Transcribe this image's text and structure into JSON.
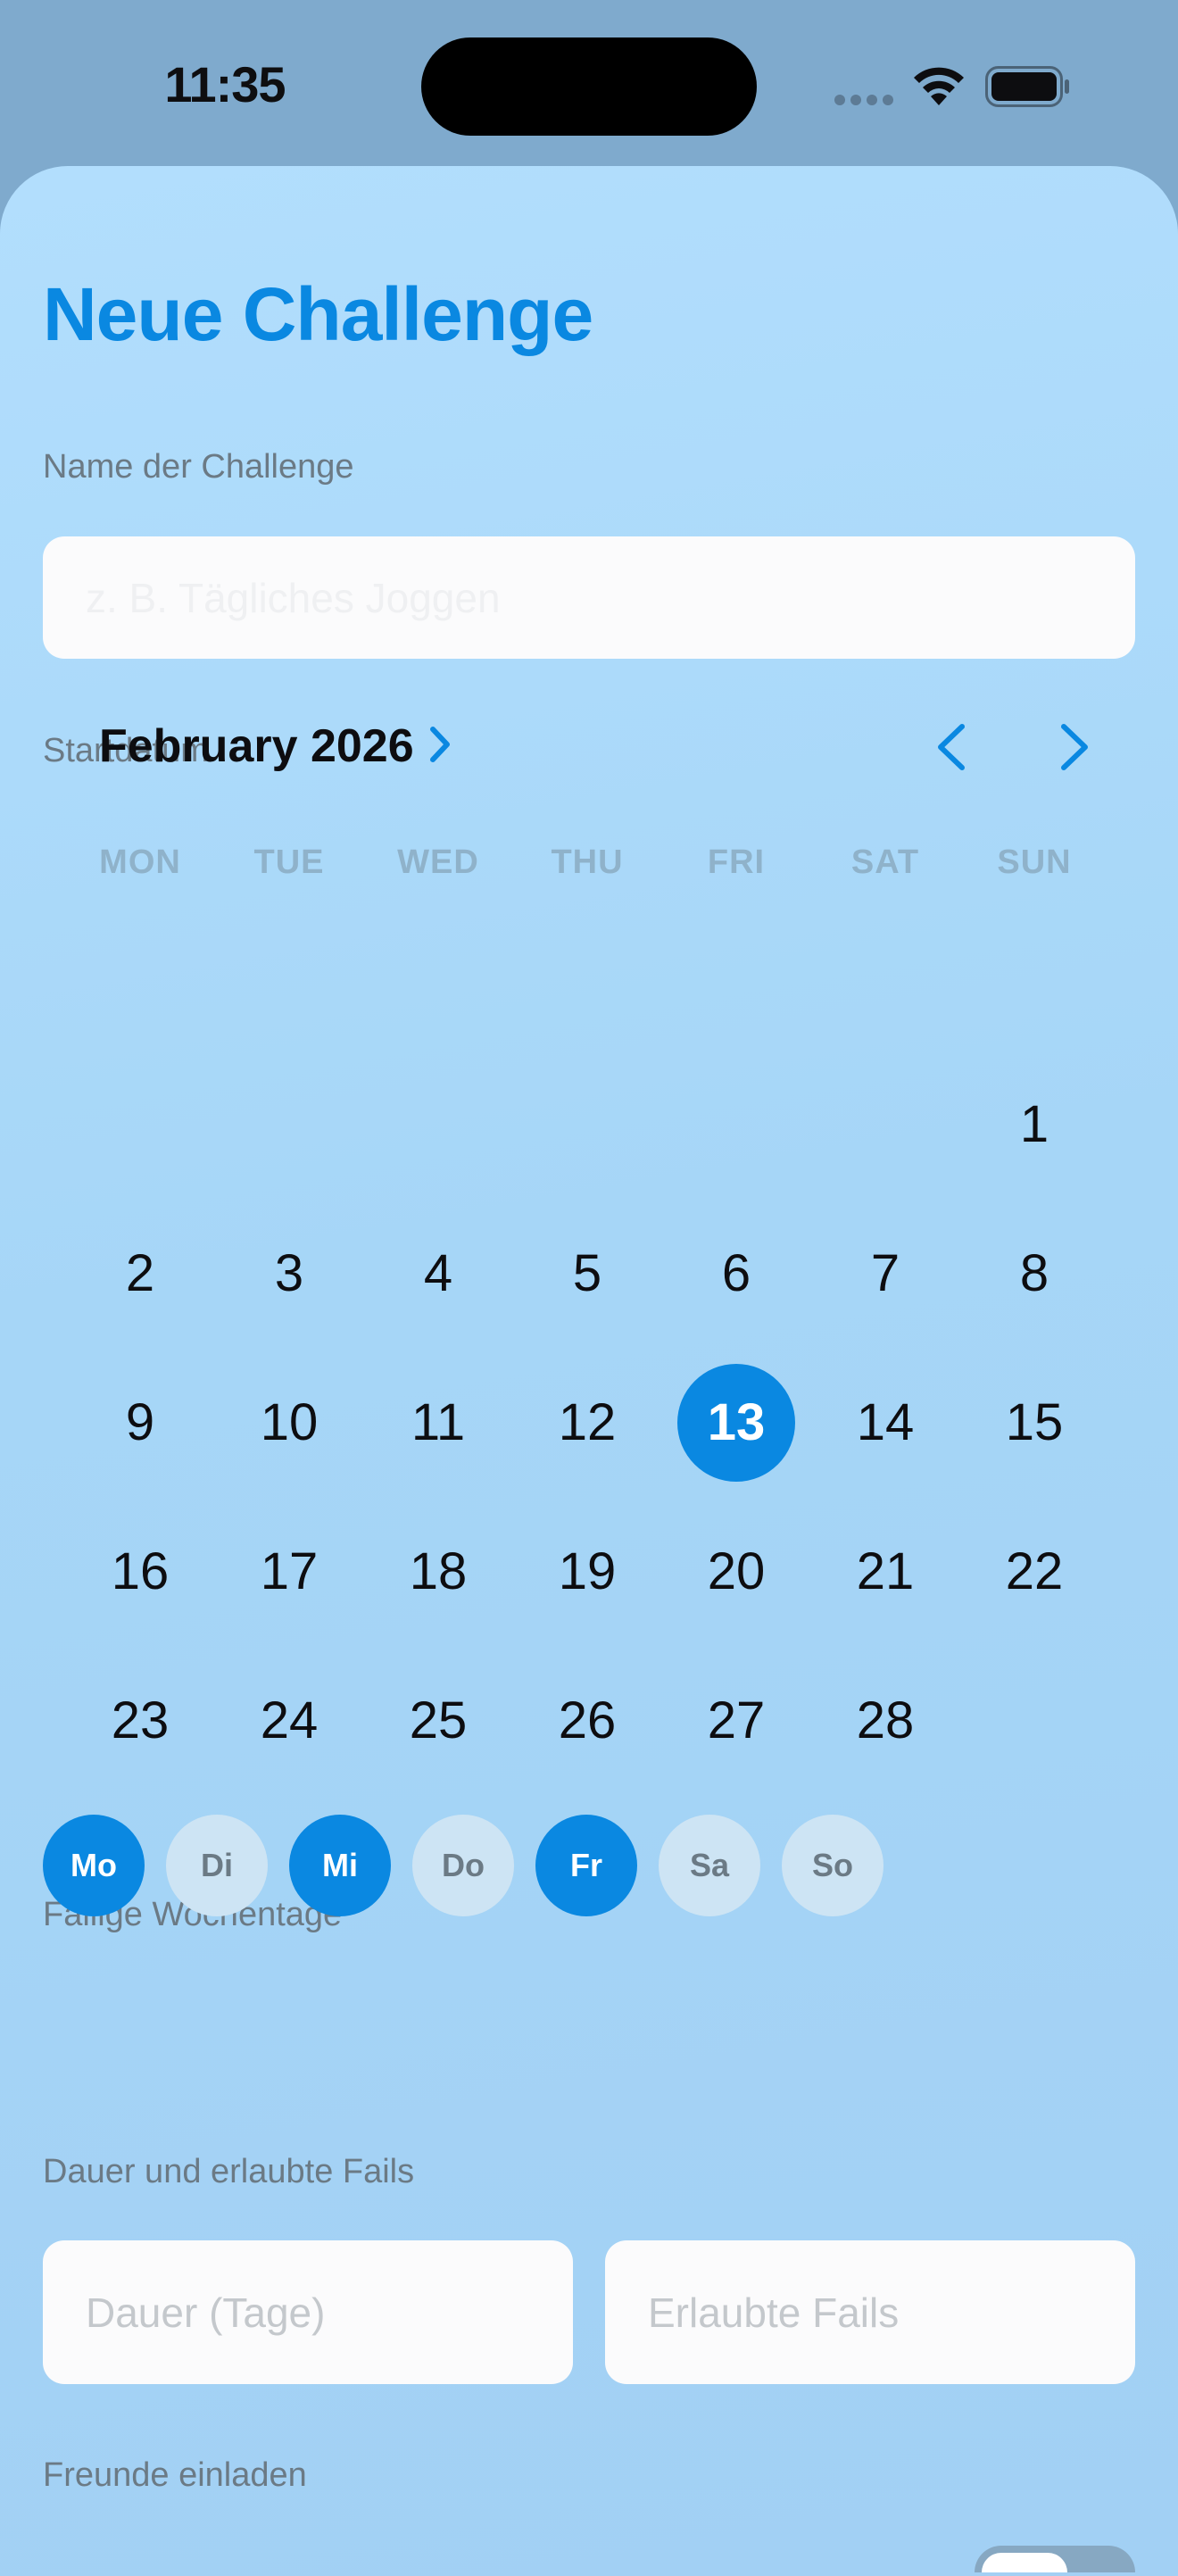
{
  "status_bar": {
    "time": "11:35"
  },
  "sheet": {
    "title": "Neue Challenge",
    "name_section": {
      "label": "Name der Challenge",
      "placeholder": "z. B. Tägliches Joggen"
    },
    "start_section": {
      "label": "Startdatum"
    },
    "calendar": {
      "month": "February 2026",
      "weekdays": [
        "MON",
        "TUE",
        "WED",
        "THU",
        "FRI",
        "SAT",
        "SUN"
      ],
      "days": [
        "1",
        "2",
        "3",
        "4",
        "5",
        "6",
        "7",
        "8",
        "9",
        "10",
        "11",
        "12",
        "13",
        "14",
        "15",
        "16",
        "17",
        "18",
        "19",
        "20",
        "21",
        "22",
        "23",
        "24",
        "25",
        "26",
        "27",
        "28"
      ],
      "selected_day": "13"
    },
    "due_days_section": {
      "label": "Fällige Wochentage",
      "days": [
        {
          "label": "Mo",
          "selected": true
        },
        {
          "label": "Di",
          "selected": false
        },
        {
          "label": "Mi",
          "selected": true
        },
        {
          "label": "Do",
          "selected": false
        },
        {
          "label": "Fr",
          "selected": true
        },
        {
          "label": "Sa",
          "selected": false
        },
        {
          "label": "So",
          "selected": false
        }
      ]
    },
    "duration_section": {
      "label": "Dauer und erlaubte Fails",
      "duration_placeholder": "Dauer (Tage)",
      "fails_placeholder": "Erlaubte Fails"
    },
    "friends_section": {
      "label": "Freunde einladen"
    }
  },
  "colors": {
    "accent": "#0a88e1",
    "sheet_background": "#abdaf9",
    "label_gray": "#6b7a85"
  },
  "icons": [
    "wifi-icon",
    "battery-icon",
    "chevron-right-icon",
    "chevron-left-icon"
  ]
}
